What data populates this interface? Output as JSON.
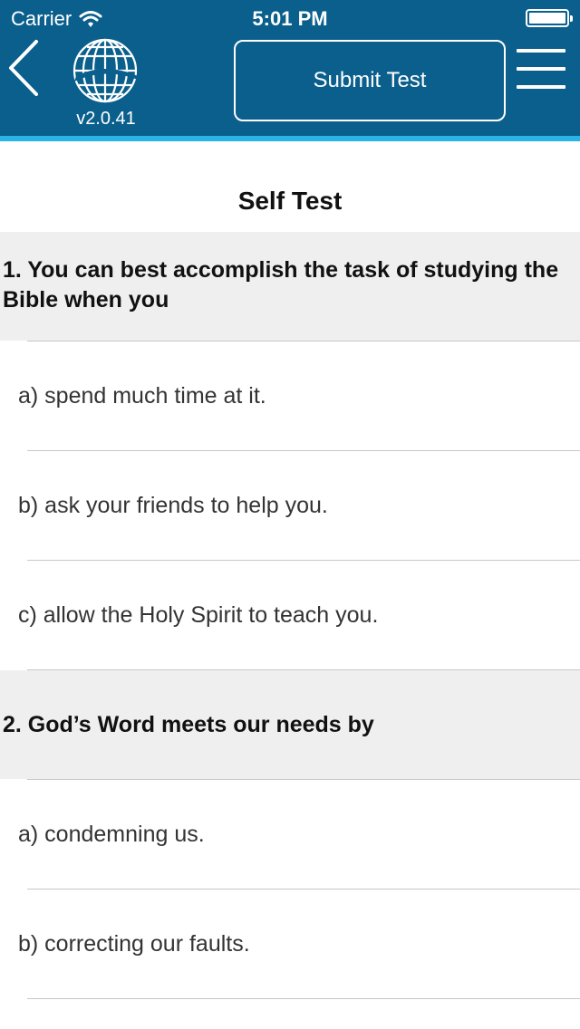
{
  "status_bar": {
    "carrier": "Carrier",
    "time": "5:01 PM"
  },
  "header": {
    "version": "v2.0.41",
    "submit_label": "Submit Test",
    "background_color": "#0a5f8c",
    "stripe_color": "#29b4e6"
  },
  "page": {
    "title": "Self Test"
  },
  "questions": [
    {
      "text": "1. You can best accomplish the task of studying the Bible when you",
      "options": [
        "a) spend much time at it.",
        "b) ask your friends to help you.",
        "c) allow the Holy Spirit to teach you."
      ]
    },
    {
      "text": "2. God’s Word meets our needs by",
      "options": [
        "a) condemning us.",
        "b) correcting our faults."
      ]
    }
  ]
}
